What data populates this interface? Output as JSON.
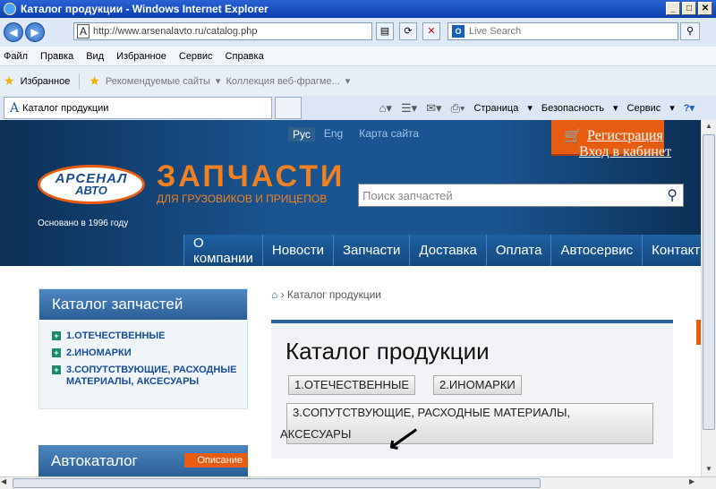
{
  "window": {
    "title": "Каталог продукции - Windows Internet Explorer"
  },
  "address": {
    "url": "http://www.arsenalavto.ru/catalog.php"
  },
  "search": {
    "placeholder": "Live Search"
  },
  "menu": [
    "Файл",
    "Правка",
    "Вид",
    "Избранное",
    "Сервис",
    "Справка"
  ],
  "favorites": {
    "label": "Избранное",
    "suggested": "Рекомендуемые сайты",
    "gallery": "Коллекция веб-фрагме..."
  },
  "tab": {
    "title": "Каталог продукции"
  },
  "commands": {
    "page": "Страница",
    "safety": "Безопасность",
    "tools": "Сервис"
  },
  "site": {
    "lang_ru": "Рус",
    "lang_en": "Eng",
    "sitemap": "Карта сайта",
    "register": "Регистрация",
    "login": "Вход в кабинет",
    "logo_top": "АРСЕНАЛ",
    "logo_bottom": "АВТО",
    "founded": "Основано в 1996 году",
    "brand": "ЗАПЧАСТИ",
    "tagline": "ДЛЯ ГРУЗОВИКОВ И ПРИЦЕПОВ",
    "search_placeholder": "Поиск запчастей",
    "nav": [
      "О компании",
      "Новости",
      "Запчасти",
      "Доставка",
      "Оплата",
      "Автосервис",
      "Контакт"
    ],
    "breadcrumb": "Каталог продукции",
    "sidebar_title": "Каталог запчастей",
    "sidebar_items": [
      "1.ОТЕЧЕСТВЕННЫЕ",
      "2.ИНОМАРКИ",
      "3.СОПУТСТВУЮЩИЕ, РАСХОДНЫЕ МАТЕРИАЛЫ, АКСЕСУАРЫ"
    ],
    "autocatalog": "Автокаталог",
    "description": "Описание",
    "main_title": "Каталог продукции",
    "cat_buttons": [
      "1.ОТЕЧЕСТВЕННЫЕ",
      "2.ИНОМАРКИ"
    ],
    "cat3_line1": "3.СОПУТСТВУЮЩИЕ, РАСХОДНЫЕ МАТЕРИАЛЫ,",
    "cat3_line2": "АКСЕСУАРЫ"
  }
}
